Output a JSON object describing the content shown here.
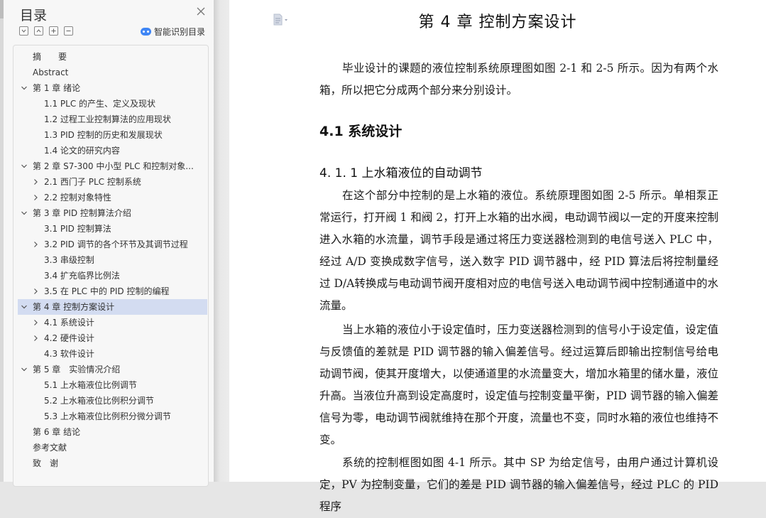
{
  "sidebar": {
    "title": "目录",
    "smart_toc_label": "智能识别目录",
    "toolbar_icons": [
      "collapse-all-icon",
      "expand-all-icon",
      "add-icon",
      "remove-icon"
    ],
    "items": [
      {
        "label": "摘　　要",
        "level": 0,
        "arrow": "none"
      },
      {
        "label": "Abstract",
        "level": 0,
        "arrow": "none"
      },
      {
        "label": "第 1 章  绪论",
        "level": 0,
        "arrow": "down"
      },
      {
        "label": "1.1 PLC 的产生、定义及现状",
        "level": 1,
        "arrow": "none"
      },
      {
        "label": "1.2  过程工业控制算法的应用现状",
        "level": 1,
        "arrow": "none"
      },
      {
        "label": "1.3 PID 控制的历史和发展现状",
        "level": 1,
        "arrow": "none"
      },
      {
        "label": "1.4  论文的研究内容",
        "level": 1,
        "arrow": "none"
      },
      {
        "label": "第 2 章  S7-300 中小型 PLC 和控制对象...",
        "level": 0,
        "arrow": "down"
      },
      {
        "label": "2.1  西门子 PLC 控制系统",
        "level": 1,
        "arrow": "right"
      },
      {
        "label": "2.2  控制对象特性",
        "level": 1,
        "arrow": "right"
      },
      {
        "label": "第 3 章  PID 控制算法介绍",
        "level": 0,
        "arrow": "down"
      },
      {
        "label": "3.1 PID 控制算法",
        "level": 1,
        "arrow": "none"
      },
      {
        "label": "3.2 PID 调节的各个环节及其调节过程",
        "level": 1,
        "arrow": "right"
      },
      {
        "label": "3.3  串级控制",
        "level": 1,
        "arrow": "none"
      },
      {
        "label": "3.4  扩充临界比例法",
        "level": 1,
        "arrow": "none"
      },
      {
        "label": "3.5 在 PLC 中的 PID 控制的编程",
        "level": 1,
        "arrow": "right"
      },
      {
        "label": "第 4 章  控制方案设计",
        "level": 0,
        "arrow": "down",
        "selected": true
      },
      {
        "label": "4.1  系统设计",
        "level": 1,
        "arrow": "right"
      },
      {
        "label": "4.2  硬件设计",
        "level": 1,
        "arrow": "right"
      },
      {
        "label": "4.3  软件设计",
        "level": 1,
        "arrow": "none"
      },
      {
        "label": "第 5 章　实验情况介绍",
        "level": 0,
        "arrow": "down"
      },
      {
        "label": "5.1  上水箱液位比例调节",
        "level": 1,
        "arrow": "none"
      },
      {
        "label": "5.2  上水箱液位比例积分调节",
        "level": 1,
        "arrow": "none"
      },
      {
        "label": "5.3  上水箱液位比例积分微分调节",
        "level": 1,
        "arrow": "none"
      },
      {
        "label": "第 6 章  结论",
        "level": 0,
        "arrow": "none"
      },
      {
        "label": "参考文献",
        "level": 0,
        "arrow": "none"
      },
      {
        "label": "致　谢",
        "level": 0,
        "arrow": "none"
      }
    ]
  },
  "document": {
    "chapter_title": "第 4 章  控制方案设计",
    "intro": "毕业设计的课题的液位控制系统原理图如图 2-1 和 2-5 所示。因为有两个水箱，所以把它分成两个部分来分别设计。",
    "section_title": "4.1  系统设计",
    "subsection_title": "4. 1. 1  上水箱液位的自动调节",
    "p1": "在这个部分中控制的是上水箱的液位。系统原理图如图 2-5 所示。单相泵正常运行，打开阀 1 和阀 2，打开上水箱的出水阀，电动调节阀以一定的开度来控制进入水箱的水流量，调节手段是通过将压力变送器检测到的电信号送入 PLC 中，经过 A/D 变换成数字信号，送入数字 PID 调节器中，经 PID 算法后将控制量经过 D/A转换成与电动调节阀开度相对应的电信号送入电动调节阀中控制通道中的水流量。",
    "p2": "当上水箱的液位小于设定值时，压力变送器检测到的信号小于设定值，设定值与反馈值的差就是 PID 调节器的输入偏差信号。经过运算后即输出控制信号给电动调节阀，使其开度增大，以使通道里的水流量变大，增加水箱里的储水量，液位升高。当液位升高到设定高度时，设定值与控制变量平衡，PID 调节器的输入偏差信号为零，电动调节阀就维持在那个开度，流量也不变，同时水箱的液位也维持不变。",
    "p3": "系统的控制框图如图 4-1 所示。其中 SP 为给定信号，由用户通过计算机设定，PV 为控制变量，它们的差是 PID 调节器的输入偏差信号，经过 PLC 的 PID 程序"
  }
}
